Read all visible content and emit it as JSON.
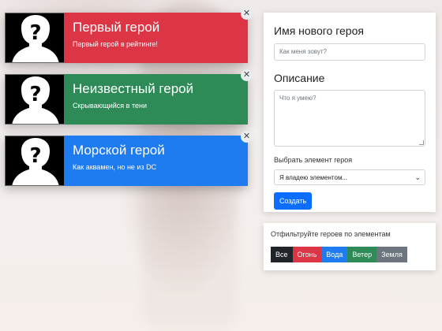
{
  "heroes": [
    {
      "name": "Первый герой",
      "desc": "Первый герой в рейтинге!",
      "color": "#dc3545"
    },
    {
      "name": "Неизвестный герой",
      "desc": "Скрывающийся в тени",
      "color": "#2e8b57"
    },
    {
      "name": "Морской герой",
      "desc": "Как аквамен, но не из DC",
      "color": "#1e7bf0"
    }
  ],
  "close_symbol": "✕",
  "form": {
    "name_heading": "Имя нового героя",
    "name_placeholder": "Как меня зовут?",
    "desc_heading": "Описание",
    "desc_placeholder": "Что я умею?",
    "element_label": "Выбрать элемент героя",
    "element_selected": "Я владею элементом...",
    "submit_label": "Создать"
  },
  "filter": {
    "title": "Отфильтруйте героев по элементам",
    "buttons": [
      "Все",
      "Огонь",
      "Вода",
      "Ветер",
      "Земля"
    ]
  }
}
